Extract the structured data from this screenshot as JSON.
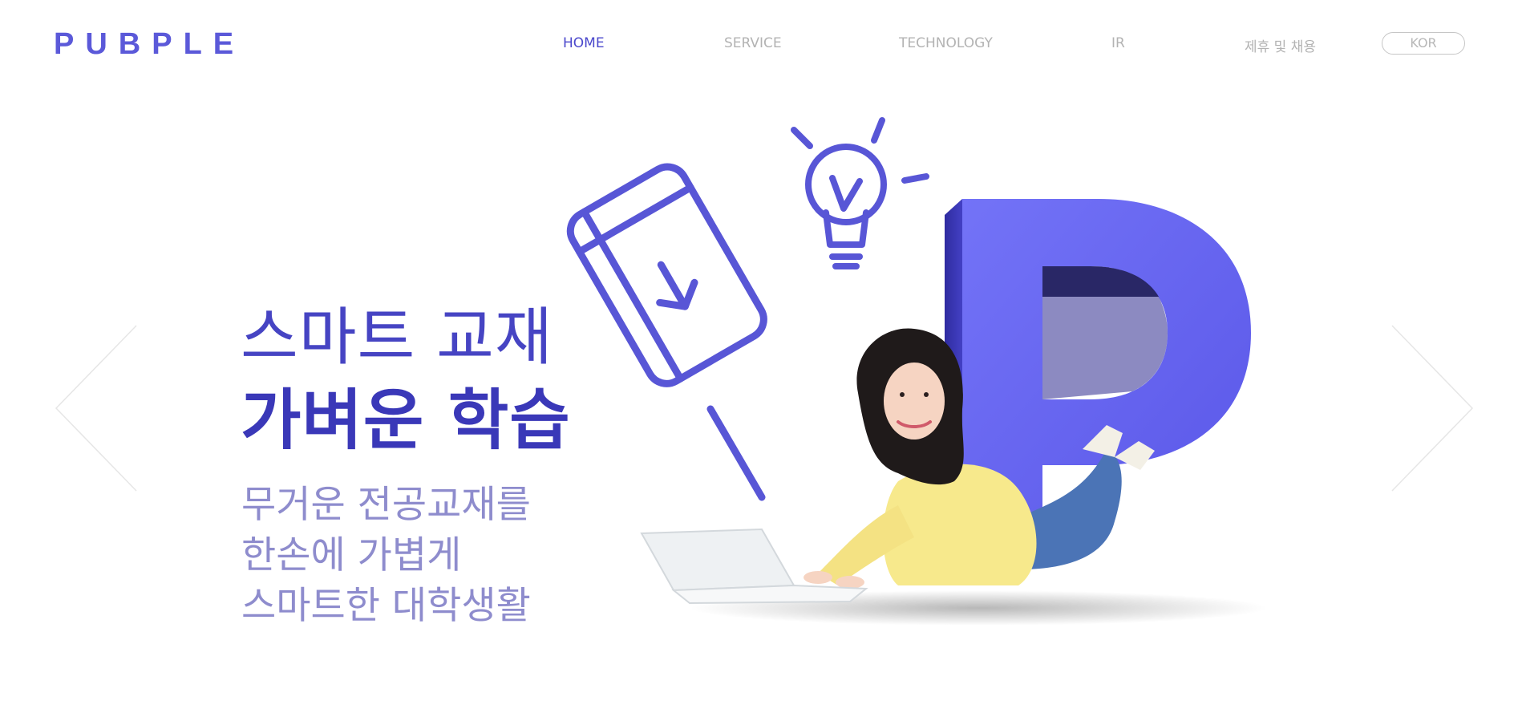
{
  "brand": {
    "logo": "PUBPLE",
    "accent": "#5b59d9"
  },
  "nav": {
    "items": [
      {
        "label": "HOME",
        "active": true
      },
      {
        "label": "SERVICE",
        "active": false
      },
      {
        "label": "TECHNOLOGY",
        "active": false
      },
      {
        "label": "IR",
        "active": false
      },
      {
        "label": "제휴 및 채용",
        "active": false
      }
    ],
    "language": "KOR"
  },
  "hero": {
    "title_line1": "스마트 교재",
    "title_line2": "가벼운 학습",
    "description": [
      "무거운 전공교재를",
      "한손에 가볍게",
      "스마트한 대학생활"
    ]
  },
  "carousel": {
    "prev_icon": "chevron-left-icon",
    "next_icon": "chevron-right-icon"
  },
  "illustration": {
    "icons": [
      "book-download-icon",
      "lightbulb-icon",
      "letter-p-3d",
      "student-with-laptop"
    ]
  }
}
